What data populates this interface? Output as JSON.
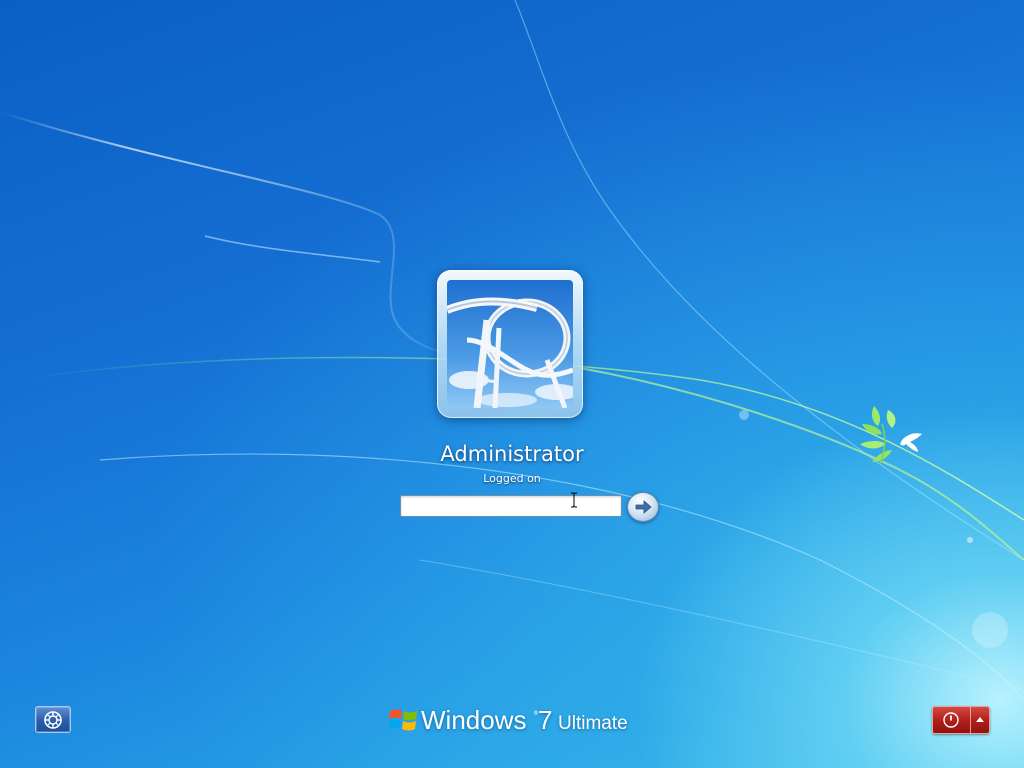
{
  "user": {
    "name": "Administrator",
    "status": "Logged on",
    "picture_icon": "roller-coaster-picture"
  },
  "password": {
    "value": "",
    "placeholder": ""
  },
  "buttons": {
    "submit_icon": "arrow-right-icon",
    "ease_of_access_icon": "ease-of-access-icon",
    "shutdown_icon": "power-icon",
    "shutdown_options_icon": "triangle-up-icon"
  },
  "branding": {
    "product": "Windows",
    "version": "7",
    "edition": "Ultimate",
    "logo_icon": "windows-flag-icon"
  },
  "colors": {
    "background_dark": "#0b5fc4",
    "background_light": "#4cc4ec",
    "shutdown_red": "#b3201b",
    "ease_access_blue": "#2a5fae"
  }
}
